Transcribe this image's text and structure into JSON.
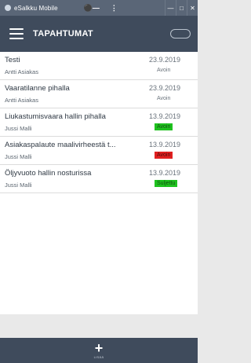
{
  "window": {
    "title": "eSalkku Mobile",
    "icon": "app-icon",
    "controls": [
      "—",
      "□",
      "✕"
    ]
  },
  "appbar": {
    "title": "TAPAHTUMAT",
    "menu_icon": "hamburger-icon",
    "logo": "esalkku"
  },
  "events": [
    {
      "name": "Testi",
      "person": "Antti Asiakas",
      "date": "23.9.2019",
      "status": "Avoin",
      "status_color": "none"
    },
    {
      "name": "Vaaratilanne pihalla",
      "person": "Antti Asiakas",
      "date": "23.9.2019",
      "status": "Avoin",
      "status_color": "none"
    },
    {
      "name": "Liukastumisvaara hallin pihalla",
      "person": "Jussi Malli",
      "date": "13.9.2019",
      "status": "Avoin",
      "status_color": "#1fc21f"
    },
    {
      "name": "Asiakaspalaute maalivirheestä t...",
      "person": "Jussi Malli",
      "date": "13.9.2019",
      "status": "Avoin",
      "status_color": "#e02020"
    },
    {
      "name": "Öljyvuoto hallin nosturissa",
      "person": "Jussi Malli",
      "date": "13.9.2019",
      "status": "Suljettu",
      "status_color": "#1fc21f"
    }
  ],
  "bottombar": {
    "add_icon": "plus-icon",
    "add_label": "LISÄÄ"
  },
  "colors": {
    "titlebar": "#5a6677",
    "appbar": "#3f4b5c",
    "green": "#1fc21f",
    "red": "#e02020"
  }
}
